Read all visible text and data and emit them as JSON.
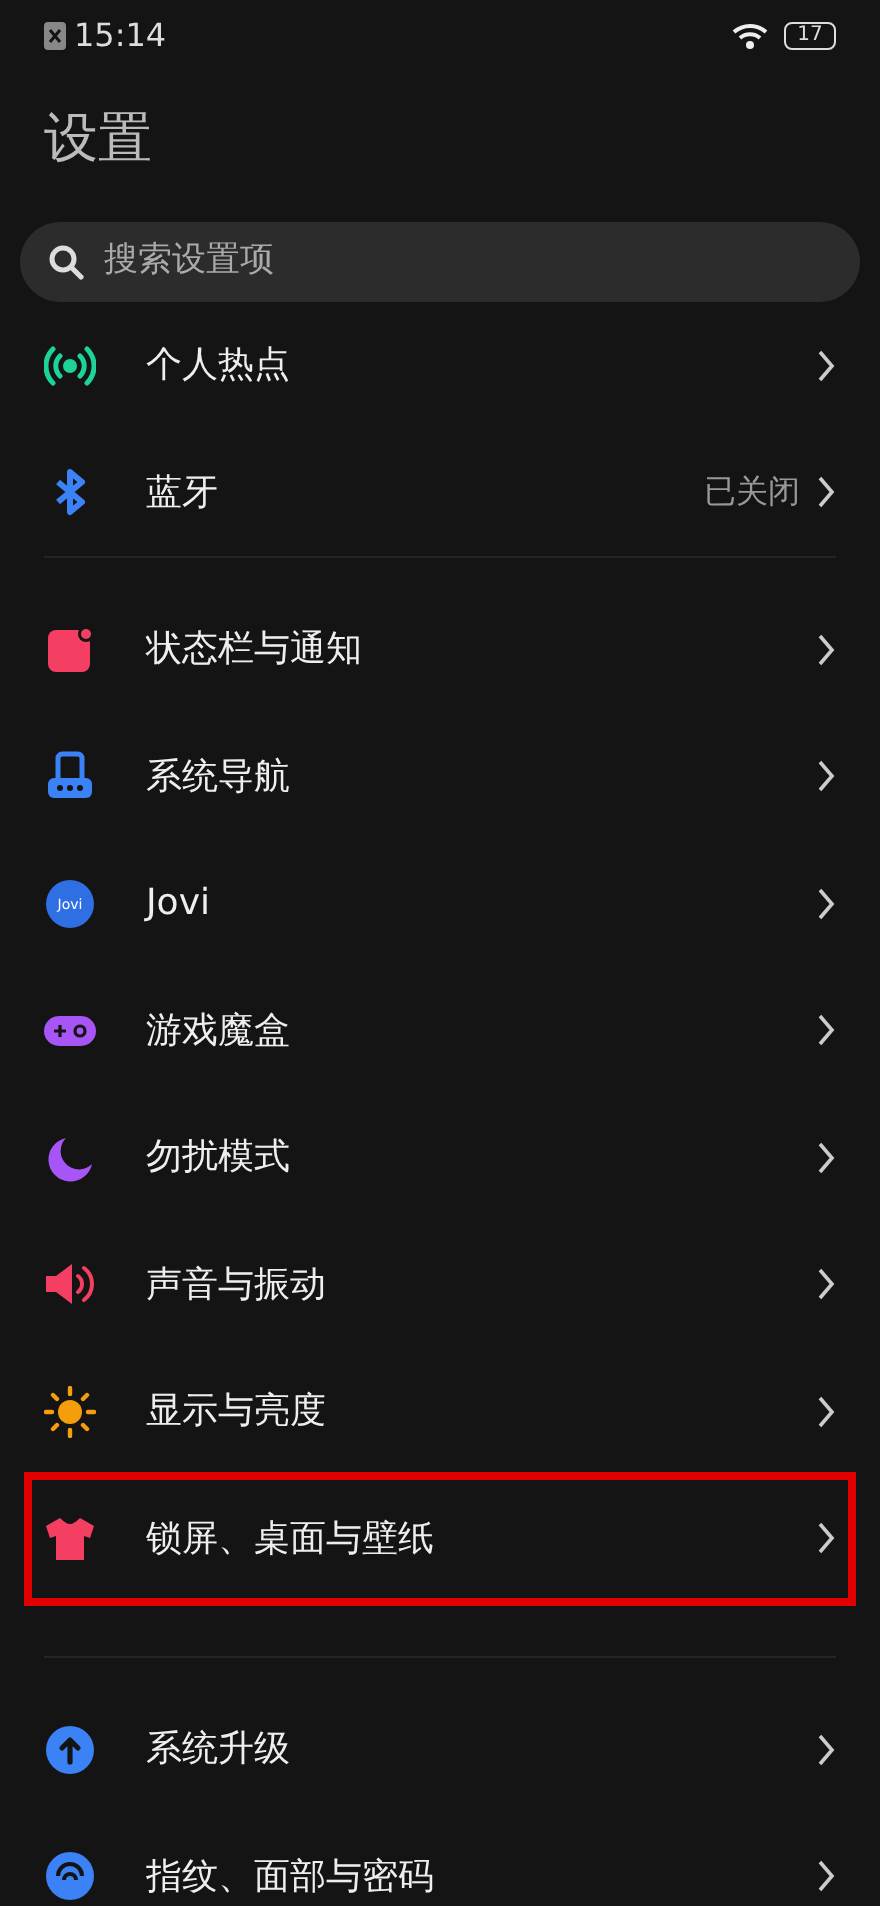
{
  "status_bar": {
    "time": "15:14",
    "battery": "17"
  },
  "title": "设置",
  "search": {
    "placeholder": "搜索设置项"
  },
  "groups": [
    {
      "items": [
        {
          "kind": "hotspot",
          "label": "个人热点",
          "highlighted": false
        },
        {
          "kind": "bluetooth",
          "label": "蓝牙",
          "value": "已关闭",
          "highlighted": false
        }
      ]
    },
    {
      "items": [
        {
          "kind": "statusbar",
          "label": "状态栏与通知",
          "highlighted": false
        },
        {
          "kind": "navigation",
          "label": "系统导航",
          "highlighted": false
        },
        {
          "kind": "jovi",
          "label": "Jovi",
          "icon_text": "Jovi",
          "highlighted": false
        },
        {
          "kind": "game",
          "label": "游戏魔盒",
          "highlighted": false
        },
        {
          "kind": "moon",
          "label": "勿扰模式",
          "highlighted": false
        },
        {
          "kind": "sound",
          "label": "声音与振动",
          "highlighted": false
        },
        {
          "kind": "sun",
          "label": "显示与亮度",
          "highlighted": false
        },
        {
          "kind": "shirt",
          "label": "锁屏、桌面与壁纸",
          "highlighted": true
        }
      ]
    },
    {
      "items": [
        {
          "kind": "upgrade",
          "label": "系统升级",
          "highlighted": false
        },
        {
          "kind": "fingerprint",
          "label": "指纹、面部与密码",
          "highlighted": false
        }
      ]
    }
  ]
}
